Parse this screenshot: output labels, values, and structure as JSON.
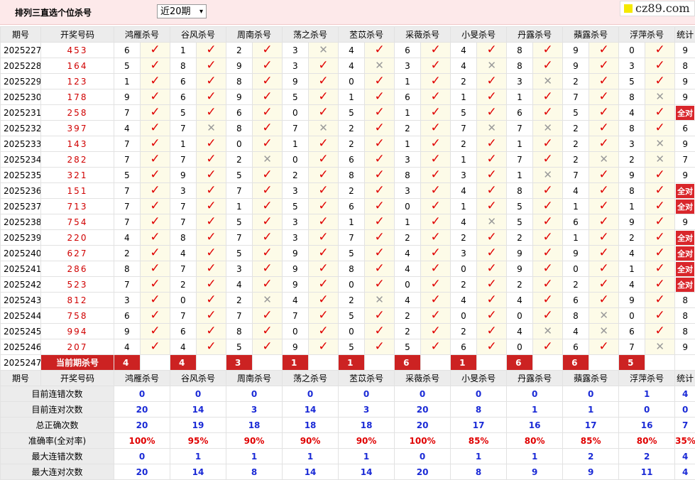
{
  "header": {
    "title": "排列三直选个位杀号",
    "period_select": "近20期",
    "site_logo": "cz89.com"
  },
  "columns": [
    "期号",
    "开奖号码",
    "鸿雁杀号",
    "谷风杀号",
    "周南杀号",
    "荡之杀号",
    "苤苡杀号",
    "采薇杀号",
    "小旻杀号",
    "丹露杀号",
    "蘋露杀号",
    "浮萍杀号",
    "统计"
  ],
  "rows": [
    {
      "period": "2025227",
      "numbers": "453",
      "kills": [
        {
          "v": "6",
          "hit": true
        },
        {
          "v": "1",
          "hit": true
        },
        {
          "v": "2",
          "hit": true
        },
        {
          "v": "3",
          "hit": false
        },
        {
          "v": "4",
          "hit": true
        },
        {
          "v": "6",
          "hit": true
        },
        {
          "v": "4",
          "hit": true
        },
        {
          "v": "8",
          "hit": true
        },
        {
          "v": "9",
          "hit": true
        },
        {
          "v": "0",
          "hit": true
        }
      ],
      "stat": "9"
    },
    {
      "period": "2025228",
      "numbers": "164",
      "kills": [
        {
          "v": "5",
          "hit": true
        },
        {
          "v": "8",
          "hit": true
        },
        {
          "v": "9",
          "hit": true
        },
        {
          "v": "3",
          "hit": true
        },
        {
          "v": "4",
          "hit": false
        },
        {
          "v": "3",
          "hit": true
        },
        {
          "v": "4",
          "hit": false
        },
        {
          "v": "8",
          "hit": true
        },
        {
          "v": "9",
          "hit": true
        },
        {
          "v": "3",
          "hit": true
        }
      ],
      "stat": "8"
    },
    {
      "period": "2025229",
      "numbers": "123",
      "kills": [
        {
          "v": "1",
          "hit": true
        },
        {
          "v": "6",
          "hit": true
        },
        {
          "v": "8",
          "hit": true
        },
        {
          "v": "9",
          "hit": true
        },
        {
          "v": "0",
          "hit": true
        },
        {
          "v": "1",
          "hit": true
        },
        {
          "v": "2",
          "hit": true
        },
        {
          "v": "3",
          "hit": false
        },
        {
          "v": "2",
          "hit": true
        },
        {
          "v": "5",
          "hit": true
        }
      ],
      "stat": "9"
    },
    {
      "period": "2025230",
      "numbers": "178",
      "kills": [
        {
          "v": "9",
          "hit": true
        },
        {
          "v": "6",
          "hit": true
        },
        {
          "v": "9",
          "hit": true
        },
        {
          "v": "5",
          "hit": true
        },
        {
          "v": "1",
          "hit": true
        },
        {
          "v": "6",
          "hit": true
        },
        {
          "v": "1",
          "hit": true
        },
        {
          "v": "1",
          "hit": true
        },
        {
          "v": "7",
          "hit": true
        },
        {
          "v": "8",
          "hit": false
        }
      ],
      "stat": "9"
    },
    {
      "period": "2025231",
      "numbers": "258",
      "kills": [
        {
          "v": "7",
          "hit": true
        },
        {
          "v": "5",
          "hit": true
        },
        {
          "v": "6",
          "hit": true
        },
        {
          "v": "0",
          "hit": true
        },
        {
          "v": "5",
          "hit": true
        },
        {
          "v": "1",
          "hit": true
        },
        {
          "v": "5",
          "hit": true
        },
        {
          "v": "6",
          "hit": true
        },
        {
          "v": "5",
          "hit": true
        },
        {
          "v": "4",
          "hit": true
        }
      ],
      "stat": "全对"
    },
    {
      "period": "2025232",
      "numbers": "397",
      "kills": [
        {
          "v": "4",
          "hit": true
        },
        {
          "v": "7",
          "hit": false
        },
        {
          "v": "8",
          "hit": true
        },
        {
          "v": "7",
          "hit": false
        },
        {
          "v": "2",
          "hit": true
        },
        {
          "v": "2",
          "hit": true
        },
        {
          "v": "7",
          "hit": false
        },
        {
          "v": "7",
          "hit": false
        },
        {
          "v": "2",
          "hit": true
        },
        {
          "v": "8",
          "hit": true
        }
      ],
      "stat": "6"
    },
    {
      "period": "2025233",
      "numbers": "143",
      "kills": [
        {
          "v": "7",
          "hit": true
        },
        {
          "v": "1",
          "hit": true
        },
        {
          "v": "0",
          "hit": true
        },
        {
          "v": "1",
          "hit": true
        },
        {
          "v": "2",
          "hit": true
        },
        {
          "v": "1",
          "hit": true
        },
        {
          "v": "2",
          "hit": true
        },
        {
          "v": "1",
          "hit": true
        },
        {
          "v": "2",
          "hit": true
        },
        {
          "v": "3",
          "hit": false
        }
      ],
      "stat": "9"
    },
    {
      "period": "2025234",
      "numbers": "282",
      "kills": [
        {
          "v": "7",
          "hit": true
        },
        {
          "v": "7",
          "hit": true
        },
        {
          "v": "2",
          "hit": false
        },
        {
          "v": "0",
          "hit": true
        },
        {
          "v": "6",
          "hit": true
        },
        {
          "v": "3",
          "hit": true
        },
        {
          "v": "1",
          "hit": true
        },
        {
          "v": "7",
          "hit": true
        },
        {
          "v": "2",
          "hit": false
        },
        {
          "v": "2",
          "hit": false
        }
      ],
      "stat": "7"
    },
    {
      "period": "2025235",
      "numbers": "321",
      "kills": [
        {
          "v": "5",
          "hit": true
        },
        {
          "v": "9",
          "hit": true
        },
        {
          "v": "5",
          "hit": true
        },
        {
          "v": "2",
          "hit": true
        },
        {
          "v": "8",
          "hit": true
        },
        {
          "v": "8",
          "hit": true
        },
        {
          "v": "3",
          "hit": true
        },
        {
          "v": "1",
          "hit": false
        },
        {
          "v": "7",
          "hit": true
        },
        {
          "v": "9",
          "hit": true
        }
      ],
      "stat": "9"
    },
    {
      "period": "2025236",
      "numbers": "151",
      "kills": [
        {
          "v": "7",
          "hit": true
        },
        {
          "v": "3",
          "hit": true
        },
        {
          "v": "7",
          "hit": true
        },
        {
          "v": "3",
          "hit": true
        },
        {
          "v": "2",
          "hit": true
        },
        {
          "v": "3",
          "hit": true
        },
        {
          "v": "4",
          "hit": true
        },
        {
          "v": "8",
          "hit": true
        },
        {
          "v": "4",
          "hit": true
        },
        {
          "v": "8",
          "hit": true
        }
      ],
      "stat": "全对"
    },
    {
      "period": "2025237",
      "numbers": "713",
      "kills": [
        {
          "v": "7",
          "hit": true
        },
        {
          "v": "7",
          "hit": true
        },
        {
          "v": "1",
          "hit": true
        },
        {
          "v": "5",
          "hit": true
        },
        {
          "v": "6",
          "hit": true
        },
        {
          "v": "0",
          "hit": true
        },
        {
          "v": "1",
          "hit": true
        },
        {
          "v": "5",
          "hit": true
        },
        {
          "v": "1",
          "hit": true
        },
        {
          "v": "1",
          "hit": true
        }
      ],
      "stat": "全对"
    },
    {
      "period": "2025238",
      "numbers": "754",
      "kills": [
        {
          "v": "7",
          "hit": true
        },
        {
          "v": "7",
          "hit": true
        },
        {
          "v": "5",
          "hit": true
        },
        {
          "v": "3",
          "hit": true
        },
        {
          "v": "1",
          "hit": true
        },
        {
          "v": "1",
          "hit": true
        },
        {
          "v": "4",
          "hit": false
        },
        {
          "v": "5",
          "hit": true
        },
        {
          "v": "6",
          "hit": true
        },
        {
          "v": "9",
          "hit": true
        }
      ],
      "stat": "9"
    },
    {
      "period": "2025239",
      "numbers": "220",
      "kills": [
        {
          "v": "4",
          "hit": true
        },
        {
          "v": "8",
          "hit": true
        },
        {
          "v": "7",
          "hit": true
        },
        {
          "v": "3",
          "hit": true
        },
        {
          "v": "7",
          "hit": true
        },
        {
          "v": "2",
          "hit": true
        },
        {
          "v": "2",
          "hit": true
        },
        {
          "v": "2",
          "hit": true
        },
        {
          "v": "1",
          "hit": true
        },
        {
          "v": "2",
          "hit": true
        }
      ],
      "stat": "全对"
    },
    {
      "period": "2025240",
      "numbers": "627",
      "kills": [
        {
          "v": "2",
          "hit": true
        },
        {
          "v": "4",
          "hit": true
        },
        {
          "v": "5",
          "hit": true
        },
        {
          "v": "9",
          "hit": true
        },
        {
          "v": "5",
          "hit": true
        },
        {
          "v": "4",
          "hit": true
        },
        {
          "v": "3",
          "hit": true
        },
        {
          "v": "9",
          "hit": true
        },
        {
          "v": "9",
          "hit": true
        },
        {
          "v": "4",
          "hit": true
        }
      ],
      "stat": "全对"
    },
    {
      "period": "2025241",
      "numbers": "286",
      "kills": [
        {
          "v": "8",
          "hit": true
        },
        {
          "v": "7",
          "hit": true
        },
        {
          "v": "3",
          "hit": true
        },
        {
          "v": "9",
          "hit": true
        },
        {
          "v": "8",
          "hit": true
        },
        {
          "v": "4",
          "hit": true
        },
        {
          "v": "0",
          "hit": true
        },
        {
          "v": "9",
          "hit": true
        },
        {
          "v": "0",
          "hit": true
        },
        {
          "v": "1",
          "hit": true
        }
      ],
      "stat": "全对"
    },
    {
      "period": "2025242",
      "numbers": "523",
      "kills": [
        {
          "v": "7",
          "hit": true
        },
        {
          "v": "2",
          "hit": true
        },
        {
          "v": "4",
          "hit": true
        },
        {
          "v": "9",
          "hit": true
        },
        {
          "v": "0",
          "hit": true
        },
        {
          "v": "0",
          "hit": true
        },
        {
          "v": "2",
          "hit": true
        },
        {
          "v": "2",
          "hit": true
        },
        {
          "v": "2",
          "hit": true
        },
        {
          "v": "4",
          "hit": true
        }
      ],
      "stat": "全对"
    },
    {
      "period": "2025243",
      "numbers": "812",
      "kills": [
        {
          "v": "3",
          "hit": true
        },
        {
          "v": "0",
          "hit": true
        },
        {
          "v": "2",
          "hit": false
        },
        {
          "v": "4",
          "hit": true
        },
        {
          "v": "2",
          "hit": false
        },
        {
          "v": "4",
          "hit": true
        },
        {
          "v": "4",
          "hit": true
        },
        {
          "v": "4",
          "hit": true
        },
        {
          "v": "6",
          "hit": true
        },
        {
          "v": "9",
          "hit": true
        }
      ],
      "stat": "8"
    },
    {
      "period": "2025244",
      "numbers": "758",
      "kills": [
        {
          "v": "6",
          "hit": true
        },
        {
          "v": "7",
          "hit": true
        },
        {
          "v": "7",
          "hit": true
        },
        {
          "v": "7",
          "hit": true
        },
        {
          "v": "5",
          "hit": true
        },
        {
          "v": "2",
          "hit": true
        },
        {
          "v": "0",
          "hit": true
        },
        {
          "v": "0",
          "hit": true
        },
        {
          "v": "8",
          "hit": false
        },
        {
          "v": "0",
          "hit": true
        }
      ],
      "stat": "8"
    },
    {
      "period": "2025245",
      "numbers": "994",
      "kills": [
        {
          "v": "9",
          "hit": true
        },
        {
          "v": "6",
          "hit": true
        },
        {
          "v": "8",
          "hit": true
        },
        {
          "v": "0",
          "hit": true
        },
        {
          "v": "0",
          "hit": true
        },
        {
          "v": "2",
          "hit": true
        },
        {
          "v": "2",
          "hit": true
        },
        {
          "v": "4",
          "hit": false
        },
        {
          "v": "4",
          "hit": false
        },
        {
          "v": "6",
          "hit": true
        }
      ],
      "stat": "8"
    },
    {
      "period": "2025246",
      "numbers": "207",
      "kills": [
        {
          "v": "4",
          "hit": true
        },
        {
          "v": "4",
          "hit": true
        },
        {
          "v": "5",
          "hit": true
        },
        {
          "v": "9",
          "hit": true
        },
        {
          "v": "5",
          "hit": true
        },
        {
          "v": "5",
          "hit": true
        },
        {
          "v": "6",
          "hit": true
        },
        {
          "v": "0",
          "hit": true
        },
        {
          "v": "6",
          "hit": true
        },
        {
          "v": "7",
          "hit": false
        }
      ],
      "stat": "9"
    }
  ],
  "current": {
    "period": "2025247",
    "label": "当前期杀号",
    "picks": [
      "4",
      "4",
      "3",
      "1",
      "1",
      "6",
      "1",
      "6",
      "6",
      "5"
    ]
  },
  "stats": [
    {
      "label": "目前连错次数",
      "values": [
        "0",
        "0",
        "0",
        "0",
        "0",
        "0",
        "0",
        "0",
        "0",
        "1"
      ],
      "stat": "4"
    },
    {
      "label": "目前连对次数",
      "values": [
        "20",
        "14",
        "3",
        "14",
        "3",
        "20",
        "8",
        "1",
        "1",
        "0"
      ],
      "stat": "0"
    },
    {
      "label": "总正确次数",
      "values": [
        "20",
        "19",
        "18",
        "18",
        "18",
        "20",
        "17",
        "16",
        "17",
        "16"
      ],
      "stat": "7"
    },
    {
      "label": "准确率(全对率)",
      "values": [
        "100%",
        "95%",
        "90%",
        "90%",
        "90%",
        "100%",
        "85%",
        "80%",
        "85%",
        "80%"
      ],
      "stat": "35%"
    },
    {
      "label": "最大连错次数",
      "values": [
        "0",
        "1",
        "1",
        "1",
        "1",
        "0",
        "1",
        "1",
        "2",
        "2"
      ],
      "stat": "4"
    },
    {
      "label": "最大连对次数",
      "values": [
        "20",
        "14",
        "8",
        "14",
        "14",
        "20",
        "8",
        "9",
        "9",
        "11"
      ],
      "stat": "4"
    }
  ]
}
